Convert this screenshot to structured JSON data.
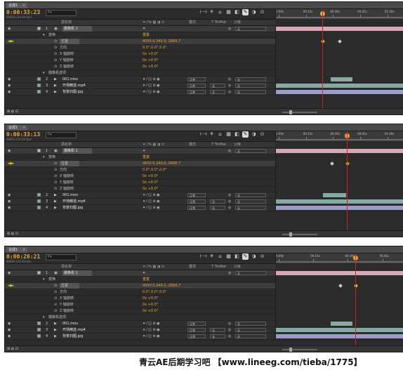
{
  "colors": {
    "accent": "#e8a533",
    "layer_pink": "#d8a9b4",
    "layer_teal": "#86aaa6",
    "layer_lavender": "#9c9cc8",
    "playhead": "#d02020"
  },
  "panel_tab": "合成1",
  "header": {
    "source_name": "源名称",
    "mode": "模式",
    "trkmat": "T TrkMat",
    "parent": "父级"
  },
  "search_placeholder": "P▾",
  "panels": [
    {
      "timecode": "0:00:33:23",
      "frames": "00816 (24.00 fps)",
      "ruler": [
        "1:00s",
        "00:15s",
        "00:30s",
        "00:45s",
        "01:00s"
      ],
      "rows": [
        {
          "type": "layer",
          "num": "1",
          "name": "摄像机 1",
          "parent": "无"
        },
        {
          "type": "group",
          "label": "变换",
          "value": "重置"
        },
        {
          "type": "prop",
          "label": "位置",
          "value": "4050.0,340.0,-2666.7"
        },
        {
          "type": "prop",
          "label": "方向",
          "value": "0.0°,0.0°,0.0°"
        },
        {
          "type": "prop",
          "label": "X 轴旋转",
          "value": "0x +0.0°"
        },
        {
          "type": "prop",
          "label": "Y 轴旋转",
          "value": "0x +0.0°"
        },
        {
          "type": "prop",
          "label": "Z 轴旋转",
          "value": "0x +0.0°"
        },
        {
          "type": "group",
          "label": "摄像机选项",
          "value": ""
        },
        {
          "type": "layer",
          "num": "2",
          "name": "001.mov",
          "mode": "正常",
          "parent": "无"
        },
        {
          "type": "layer",
          "num": "3",
          "name": "开场精选.mp4",
          "mode": "正常",
          "trkmat": "无",
          "parent": "无"
        },
        {
          "type": "layer",
          "num": "4",
          "name": "背景扫图.jpg",
          "mode": "正常",
          "trkmat": "无",
          "parent": "无"
        }
      ]
    },
    {
      "timecode": "0:00:33:13",
      "frames": "00813 (24.00 fps)",
      "ruler": [
        "1:00s",
        "00:15s",
        "00:30s",
        "00:45s",
        "01:00s"
      ],
      "rows": [
        {
          "type": "layer",
          "num": "1",
          "name": "摄像机 1",
          "parent": "无"
        },
        {
          "type": "group",
          "label": "变换",
          "value": "重置"
        },
        {
          "type": "prop",
          "label": "位置",
          "value": "4650.0,340.0,-2666.7"
        },
        {
          "type": "prop",
          "label": "方向",
          "value": "0.0°,0.0°,0.0°"
        },
        {
          "type": "prop",
          "label": "X 轴旋转",
          "value": "0x +0.0°"
        },
        {
          "type": "prop",
          "label": "Y 轴旋转",
          "value": "0x +0.0°"
        },
        {
          "type": "prop",
          "label": "Z 轴旋转",
          "value": "0x +0.0°"
        },
        {
          "type": "layer",
          "num": "2",
          "name": "001.mov",
          "mode": "正常",
          "parent": "无"
        },
        {
          "type": "layer",
          "num": "3",
          "name": "开场精选.mp4",
          "mode": "正常",
          "trkmat": "无",
          "parent": "无"
        },
        {
          "type": "layer",
          "num": "4",
          "name": "背景扫图.jpg",
          "mode": "正常",
          "trkmat": "无",
          "parent": "无"
        }
      ]
    },
    {
      "timecode": "0:00:28:21",
      "frames": "00693 (24.00 fps)",
      "ruler": [
        "0:00s",
        "00:15s",
        "00:30s",
        "00:45s"
      ],
      "rows": [
        {
          "type": "layer",
          "num": "1",
          "name": "摄像机 1",
          "parent": "无"
        },
        {
          "type": "group",
          "label": "变换",
          "value": "重置"
        },
        {
          "type": "prop",
          "label": "位置",
          "value": "4050.0,340.0,-2666.7"
        },
        {
          "type": "prop",
          "label": "方向",
          "value": "0.0°,0.0°,0.0°"
        },
        {
          "type": "prop",
          "label": "X 轴旋转",
          "value": "0x +0.0°"
        },
        {
          "type": "prop",
          "label": "Y 轴旋转",
          "value": "0x +0.0°"
        },
        {
          "type": "prop",
          "label": "Z 轴旋转",
          "value": "0x +0.0°"
        },
        {
          "type": "group",
          "label": "摄像机选项",
          "value": ""
        },
        {
          "type": "layer",
          "num": "2",
          "name": "001.mov",
          "mode": "正常",
          "parent": "无"
        },
        {
          "type": "layer",
          "num": "3",
          "name": "开场精选.mp4",
          "mode": "正常",
          "trkmat": "无",
          "parent": "无"
        },
        {
          "type": "layer",
          "num": "4",
          "name": "背景扫图.jpg",
          "mode": "正常",
          "trkmat": "无",
          "parent": "无"
        }
      ]
    }
  ],
  "watermark": "青云AE后期学习吧 【www.lineeg.com/tieba/1775】"
}
